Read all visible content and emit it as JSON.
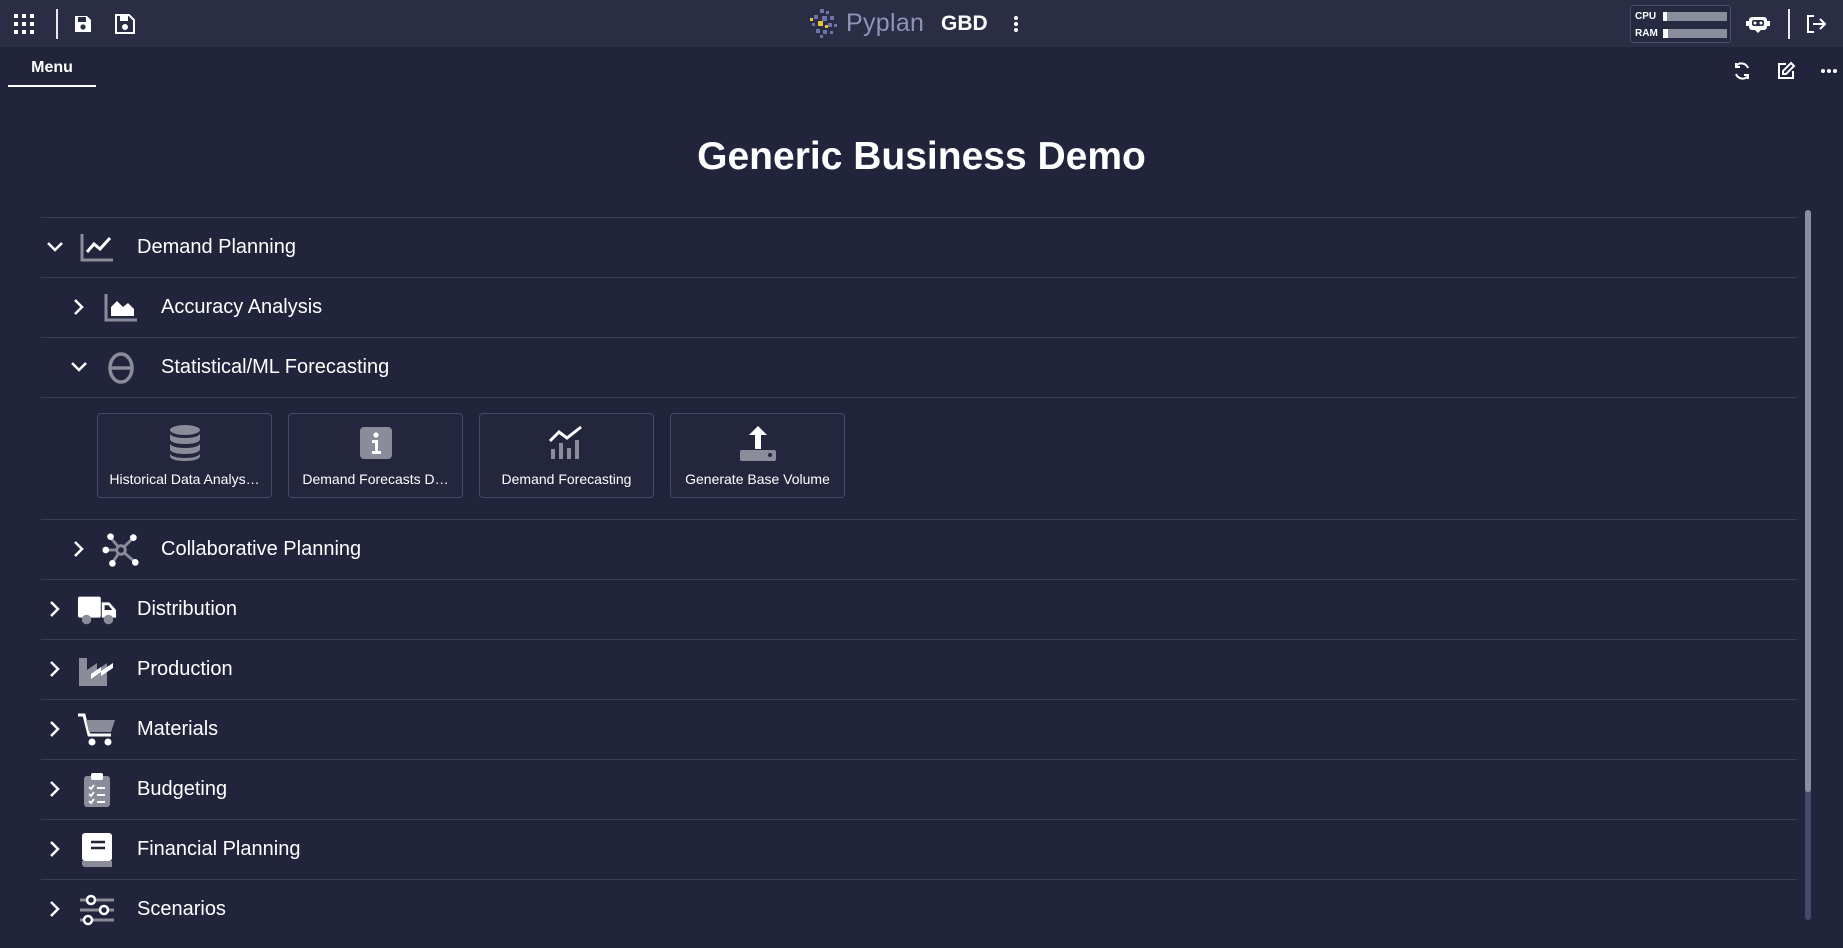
{
  "app": {
    "logo_text": "Pyplan",
    "app_code": "GBD",
    "resources": {
      "cpu_label": "CPU",
      "ram_label": "RAM",
      "cpu_level": 0.03,
      "ram_level": 0.05
    }
  },
  "toolbar": {
    "apps_icon": "grid-icon",
    "save_icon": "save-icon",
    "save_as_icon": "save-as-icon",
    "more_icon": "kebab-icon",
    "assistant_icon": "robot-icon",
    "logout_icon": "logout-icon"
  },
  "tabs": {
    "menu_label": "Menu"
  },
  "actions": {
    "refresh_icon": "refresh-icon",
    "edit_icon": "edit-icon",
    "more_icon": "ellipsis-icon"
  },
  "page": {
    "title": "Generic Business Demo"
  },
  "menu": {
    "demand_planning": "Demand Planning",
    "accuracy_analysis": "Accuracy Analysis",
    "statistical_ml": "Statistical/ML Forecasting",
    "cards": [
      "Historical Data Analys…",
      "Demand Forecasts D…",
      "Demand Forecasting",
      "Generate Base Volume"
    ],
    "collaborative_planning": "Collaborative Planning",
    "distribution": "Distribution",
    "production": "Production",
    "materials": "Materials",
    "budgeting": "Budgeting",
    "financial_planning": "Financial Planning",
    "scenarios": "Scenarios"
  },
  "colors": {
    "background": "#21243a",
    "topbar": "#2a2d44",
    "icon_gray": "#8a8c9a",
    "text": "#ffffff"
  }
}
